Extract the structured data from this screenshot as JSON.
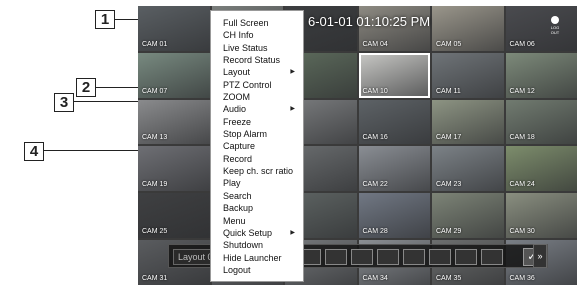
{
  "callouts": [
    {
      "number": "1"
    },
    {
      "number": "2"
    },
    {
      "number": "3"
    },
    {
      "number": "4"
    }
  ],
  "timestamp": "6-01-01 01:10:25 PM",
  "logout_label": "LOG OUT",
  "launcher": {
    "layout_label": "Layout 01",
    "more_label": "»",
    "check_label": "✓"
  },
  "cameras": [
    {
      "label": "CAM 01",
      "color": "#5a5f63"
    },
    {
      "label": "",
      "color": "#7a7e7c"
    },
    {
      "label": "",
      "color": "#3c3e40"
    },
    {
      "label": "CAM 04",
      "color": "#8d8a82"
    },
    {
      "label": "CAM 05",
      "color": "#9a968b"
    },
    {
      "label": "CAM 06",
      "color": "#4a4b4f"
    },
    {
      "label": "CAM 07",
      "color": "#788a80"
    },
    {
      "label": "",
      "color": "#70737a"
    },
    {
      "label": "",
      "color": "#5d6b5c"
    },
    {
      "label": "CAM 10",
      "color": "#c9c9c6"
    },
    {
      "label": "CAM 11",
      "color": "#6f7478"
    },
    {
      "label": "CAM 12",
      "color": "#7d8a7a"
    },
    {
      "label": "CAM 13",
      "color": "#8a8b8d"
    },
    {
      "label": "",
      "color": "#686a6c"
    },
    {
      "label": "",
      "color": "#7a7c7e"
    },
    {
      "label": "CAM 16",
      "color": "#5d6266"
    },
    {
      "label": "CAM 17",
      "color": "#8d9483"
    },
    {
      "label": "CAM 18",
      "color": "#717b70"
    },
    {
      "label": "CAM 19",
      "color": "#6e6f74"
    },
    {
      "label": "",
      "color": "#85868a"
    },
    {
      "label": "",
      "color": "#6a6d6f"
    },
    {
      "label": "CAM 22",
      "color": "#8a8e94"
    },
    {
      "label": "CAM 23",
      "color": "#7c8287"
    },
    {
      "label": "CAM 24",
      "color": "#7d8d6c"
    },
    {
      "label": "CAM 25",
      "color": "#3f4042"
    },
    {
      "label": "",
      "color": "#6a6c70"
    },
    {
      "label": "",
      "color": "#5e6463"
    },
    {
      "label": "CAM 28",
      "color": "#717884"
    },
    {
      "label": "CAM 29",
      "color": "#7d8477"
    },
    {
      "label": "CAM 30",
      "color": "#8a8f80"
    },
    {
      "label": "CAM 31",
      "color": "#5a5c5f"
    },
    {
      "label": "",
      "color": "#6d6f72"
    },
    {
      "label": "",
      "color": "#76797c"
    },
    {
      "label": "CAM 34",
      "color": "#8b8f94"
    },
    {
      "label": "CAM 35",
      "color": "#6d6f6f"
    },
    {
      "label": "CAM 36",
      "color": "#7a7f86"
    }
  ],
  "menu": {
    "items": [
      {
        "label": "Full Screen",
        "submenu": false
      },
      {
        "label": "CH Info",
        "submenu": false
      },
      {
        "label": "Live Status",
        "submenu": false
      },
      {
        "label": "Record Status",
        "submenu": false
      },
      {
        "label": "Layout",
        "submenu": true
      },
      {
        "label": "PTZ Control",
        "submenu": false
      },
      {
        "label": "ZOOM",
        "submenu": false
      },
      {
        "label": "Audio",
        "submenu": true
      },
      {
        "label": "Freeze",
        "submenu": false
      },
      {
        "label": "Stop Alarm",
        "submenu": false
      },
      {
        "label": "Capture",
        "submenu": false
      },
      {
        "label": "Record",
        "submenu": false
      },
      {
        "label": "Keep ch. scr ratio",
        "submenu": false
      },
      {
        "label": "Play",
        "submenu": false
      },
      {
        "label": "Search",
        "submenu": false
      },
      {
        "label": "Backup",
        "submenu": false
      },
      {
        "label": "Menu",
        "submenu": false
      },
      {
        "label": "Quick Setup",
        "submenu": true
      },
      {
        "label": "Shutdown",
        "submenu": false
      },
      {
        "label": "Hide Launcher",
        "submenu": false
      },
      {
        "label": "Logout",
        "submenu": false
      }
    ],
    "submenu_arrow": "▶"
  }
}
